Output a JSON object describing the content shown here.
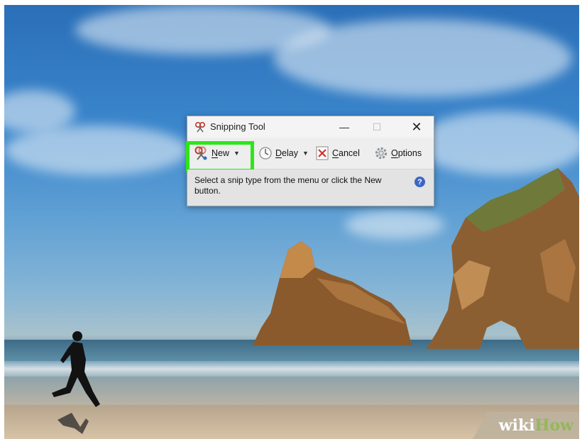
{
  "window": {
    "title": "Snipping Tool",
    "minimize_glyph": "—",
    "maximize_glyph": "☐",
    "close_glyph": "✕"
  },
  "toolbar": {
    "new": {
      "label_underlined": "N",
      "label_rest": "ew",
      "icon": "scissors-icon"
    },
    "delay": {
      "label_underlined": "D",
      "label_rest": "elay",
      "icon": "clock-icon"
    },
    "cancel": {
      "label_underlined": "C",
      "label_rest": "ancel",
      "icon": "cancel-x-icon"
    },
    "options": {
      "label_underlined": "O",
      "label_rest": "ptions",
      "icon": "gear-icon"
    },
    "dropdown_glyph": "▼"
  },
  "status": {
    "message": "Select a snip type from the menu or click the New button.",
    "help_glyph": "?"
  },
  "highlight_color": "#2ce619",
  "watermark": {
    "part1": "wiki",
    "part2": "How"
  }
}
